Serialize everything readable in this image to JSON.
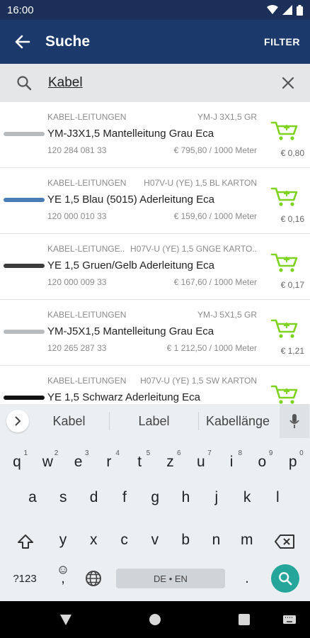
{
  "status": {
    "time": "16:00"
  },
  "appbar": {
    "title": "Suche",
    "filter_label": "FILTER"
  },
  "search": {
    "value": "Kabel"
  },
  "items": [
    {
      "category": "KABEL-LEITUNGEN",
      "code": "YM-J 3X1,5 GR",
      "name": "YM-J3X1,5 Mantelleitung Grau Eca",
      "artno": "120 284 081 33",
      "price": "€ 795,80 / 1000 Meter",
      "unit_price": "€ 0,80",
      "thumb_color": "#b9bcbf"
    },
    {
      "category": "KABEL-LEITUNGEN",
      "code": "H07V-U (YE) 1,5 BL KARTON",
      "name": "YE 1,5 Blau (5015) Aderleitung Eca",
      "artno": "120 000 010 33",
      "price": "€ 159,60 / 1000 Meter",
      "unit_price": "€ 0,16",
      "thumb_color": "#4a7db5"
    },
    {
      "category": "KABEL-LEITUNGE..",
      "code": "H07V-U (YE) 1,5 GNGE KARTO..",
      "name": "YE 1,5 Gruen/Gelb Aderleitung Eca",
      "artno": "120 000 009 33",
      "price": "€ 167,60 / 1000 Meter",
      "unit_price": "€ 0,17",
      "thumb_color": "#3b3b3b"
    },
    {
      "category": "KABEL-LEITUNGEN",
      "code": "YM-J 5X1,5 GR",
      "name": "YM-J5X1,5 Mantelleitung Grau Eca",
      "artno": "120 265 287 33",
      "price": "€ 1 212,50 / 1000 Meter",
      "unit_price": "€ 1,21",
      "thumb_color": "#b9bcbf"
    },
    {
      "category": "KABEL-LEITUNGEN",
      "code": "H07V-U (YE) 1,5 SW KARTON",
      "name": "YE 1,5 Schwarz Aderleitung Eca",
      "artno": "",
      "price": "",
      "unit_price": "",
      "thumb_color": "#111111"
    }
  ],
  "keyboard": {
    "suggestions": [
      "Kabel",
      "Label",
      "Kabellänge"
    ],
    "row1": [
      {
        "k": "q",
        "n": "1"
      },
      {
        "k": "w",
        "n": "2"
      },
      {
        "k": "e",
        "n": "3"
      },
      {
        "k": "r",
        "n": "4"
      },
      {
        "k": "t",
        "n": "5"
      },
      {
        "k": "z",
        "n": "6"
      },
      {
        "k": "u",
        "n": "7"
      },
      {
        "k": "i",
        "n": "8"
      },
      {
        "k": "o",
        "n": "9"
      },
      {
        "k": "p",
        "n": "0"
      }
    ],
    "row2": [
      "a",
      "s",
      "d",
      "f",
      "g",
      "h",
      "j",
      "k",
      "l"
    ],
    "row3": [
      "y",
      "x",
      "c",
      "v",
      "b",
      "n",
      "m"
    ],
    "numbers_label": "?123",
    "comma_label": ",",
    "period_label": ".",
    "space_label": "DE • EN"
  },
  "colors": {
    "accent": "#1b3a6b",
    "cart": "#7ed321",
    "search_fab": "#26a69a"
  }
}
